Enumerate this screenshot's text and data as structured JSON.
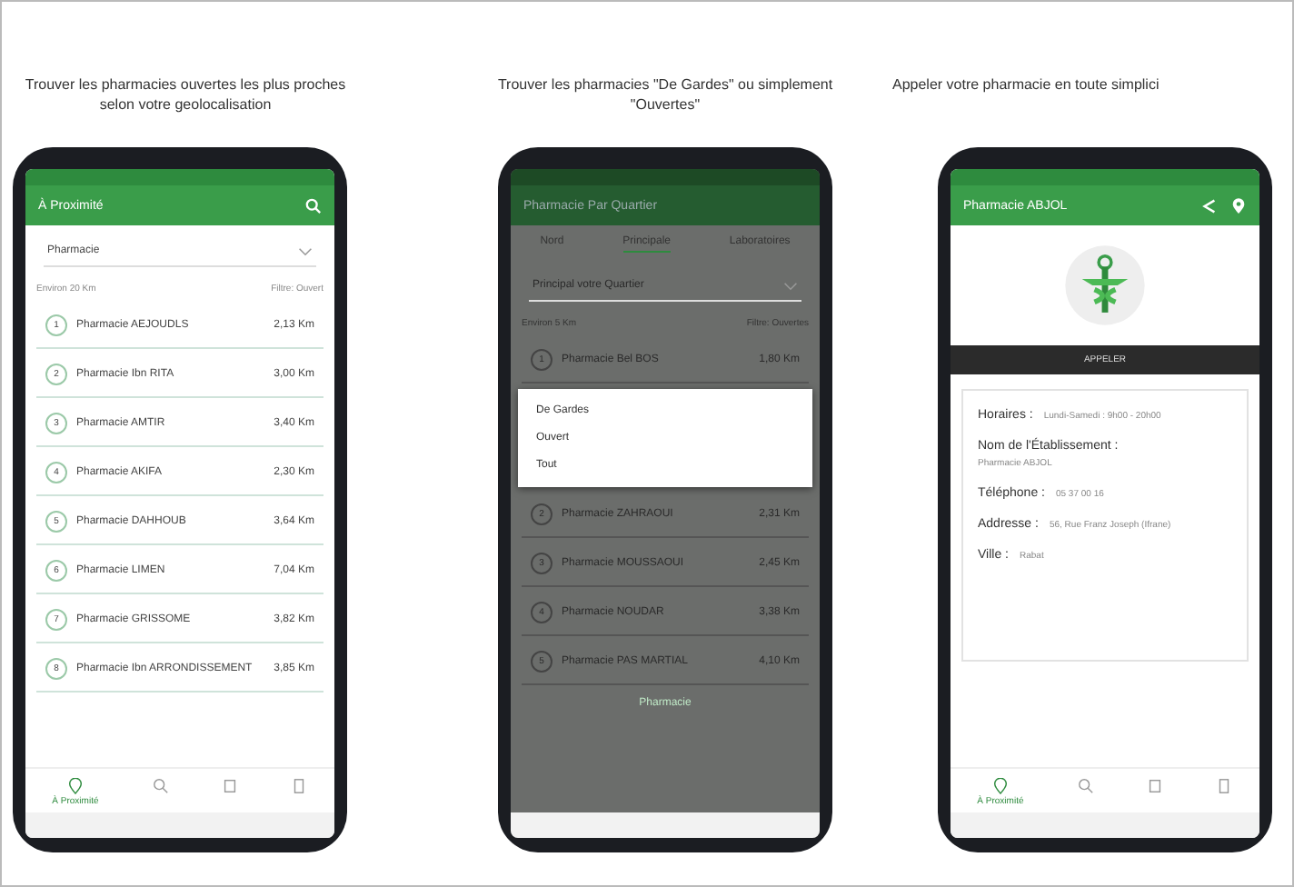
{
  "panels": [
    {
      "kind": "list",
      "caption": "Trouver les pharmacies ouvertes les plus proches selon votre geolocalisation",
      "screen": {
        "title": "À Proximité",
        "select": "Pharmacie",
        "filters": [
          "Environ 20 Km",
          "Filtre: Ouvert"
        ],
        "items": [
          {
            "number": "1",
            "name": "Pharmacie AEJOUDLS",
            "distance": "2,13 Km"
          },
          {
            "number": "2",
            "name": "Pharmacie Ibn RITA",
            "distance": "3,00 Km"
          },
          {
            "number": "3",
            "name": "Pharmacie AMTIR",
            "distance": "3,40 Km"
          },
          {
            "number": "4",
            "name": "Pharmacie AKIFA",
            "distance": "2,30 Km"
          },
          {
            "number": "5",
            "name": "Pharmacie DAHHOUB",
            "distance": "3,64 Km"
          },
          {
            "number": "6",
            "name": "Pharmacie LIMEN",
            "distance": "7,04 Km"
          },
          {
            "number": "7",
            "name": "Pharmacie GRISSOME",
            "distance": "3,82 Km"
          },
          {
            "number": "8",
            "name": "Pharmacie Ibn ARRONDISSEMENT",
            "distance": "3,85 Km"
          }
        ],
        "nav": [
          {
            "kind": "pin",
            "label": "À Proximité",
            "selected": true
          },
          {
            "kind": "search",
            "selected": false
          },
          {
            "kind": "list",
            "selected": false
          },
          {
            "kind": "info",
            "selected": false
          }
        ]
      }
    },
    {
      "kind": "dialog",
      "caption": "Trouver les pharmacies \"De Gardes\" ou simplement \"Ouvertes\"",
      "screen": {
        "title": "Pharmacie Par Quartier",
        "tabs": [
          {
            "label": "Nord",
            "selected": false
          },
          {
            "label": "Principale",
            "selected": true
          },
          {
            "label": "Laboratoires",
            "selected": false
          }
        ],
        "select": "Principal votre Quartier",
        "filters": [
          "Environ 5 Km",
          "Filtre: Ouvertes"
        ],
        "items": [
          {
            "number": "1",
            "name": "Pharmacie Bel BOS",
            "distance": "1,80 Km"
          },
          {
            "number": "2",
            "name": "Pharmacie ZAHRAOUI",
            "distance": "2,31 Km"
          },
          {
            "number": "3",
            "name": "Pharmacie MOUSSAOUI",
            "distance": "2,45 Km"
          },
          {
            "number": "4",
            "name": "Pharmacie NOUDAR",
            "distance": "3,38 Km"
          },
          {
            "number": "5",
            "name": "Pharmacie PAS MARTIAL",
            "distance": "4,10 Km"
          }
        ],
        "options": [
          "De Gardes",
          "Ouvert",
          "Tout"
        ],
        "footer": "Pharmacie"
      }
    },
    {
      "kind": "detail",
      "caption": "Appeler votre pharmacie en toute simplici",
      "screen": {
        "title": "Pharmacie ABJOL",
        "call": "APPELER",
        "fields": [
          {
            "label": "Horaires :",
            "value": "Lundi-Samedi : 9h00 - 20h00",
            "below": false
          },
          {
            "label": "Nom de l'Établissement :",
            "value": "Pharmacie ABJOL",
            "below": true
          },
          {
            "label": "Téléphone :",
            "value": "05 37 00 16",
            "below": false
          },
          {
            "label": "Addresse :",
            "value": "56, Rue Franz Joseph (Ifrane)",
            "below": false
          },
          {
            "label": "Ville :",
            "value": "Rabat",
            "below": false
          }
        ],
        "nav": [
          {
            "kind": "pin",
            "label": "À Proximité",
            "selected": true
          },
          {
            "kind": "search",
            "selected": false
          },
          {
            "kind": "list",
            "selected": false
          },
          {
            "kind": "info",
            "selected": false
          }
        ]
      }
    }
  ]
}
